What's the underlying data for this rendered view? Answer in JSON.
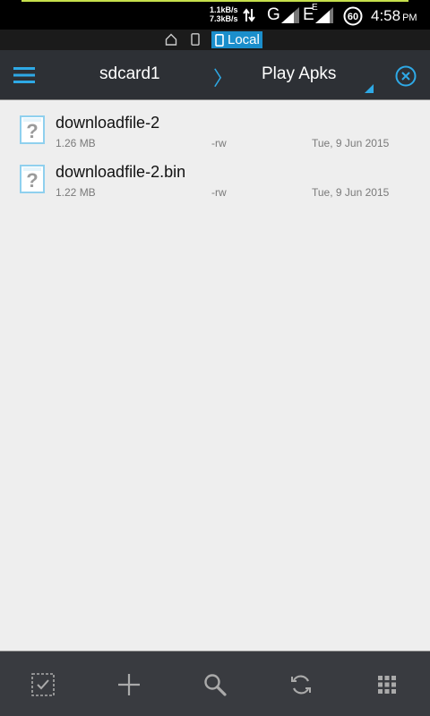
{
  "status_bar": {
    "upload_speed": "1.1kB/s",
    "download_speed": "7.3kB/s",
    "network_1": "G",
    "network_2": "E",
    "network_2_sup": "E",
    "battery_level": "60",
    "time": "4:58",
    "ampm": "PM",
    "accent_color": "#c6e04c"
  },
  "location_bar": {
    "local_label": "Local",
    "highlight_color": "#1b8ecb"
  },
  "toolbar": {
    "crumbs": [
      "sdcard1",
      "Play Apks"
    ],
    "separator": "〉",
    "accent_color": "#2ea9e6"
  },
  "files": [
    {
      "name": "downloadfile-2",
      "size": "1.26 MB",
      "permissions": "-rw",
      "date": "Tue, 9 Jun 2015",
      "icon": "unknown-file-icon"
    },
    {
      "name": "downloadfile-2.bin",
      "size": "1.22 MB",
      "permissions": "-rw",
      "date": "Tue, 9 Jun 2015",
      "icon": "unknown-file-icon"
    }
  ],
  "bottom_bar": {
    "buttons": [
      "select-icon",
      "add-icon",
      "search-icon",
      "refresh-icon",
      "grid-view-icon"
    ]
  }
}
